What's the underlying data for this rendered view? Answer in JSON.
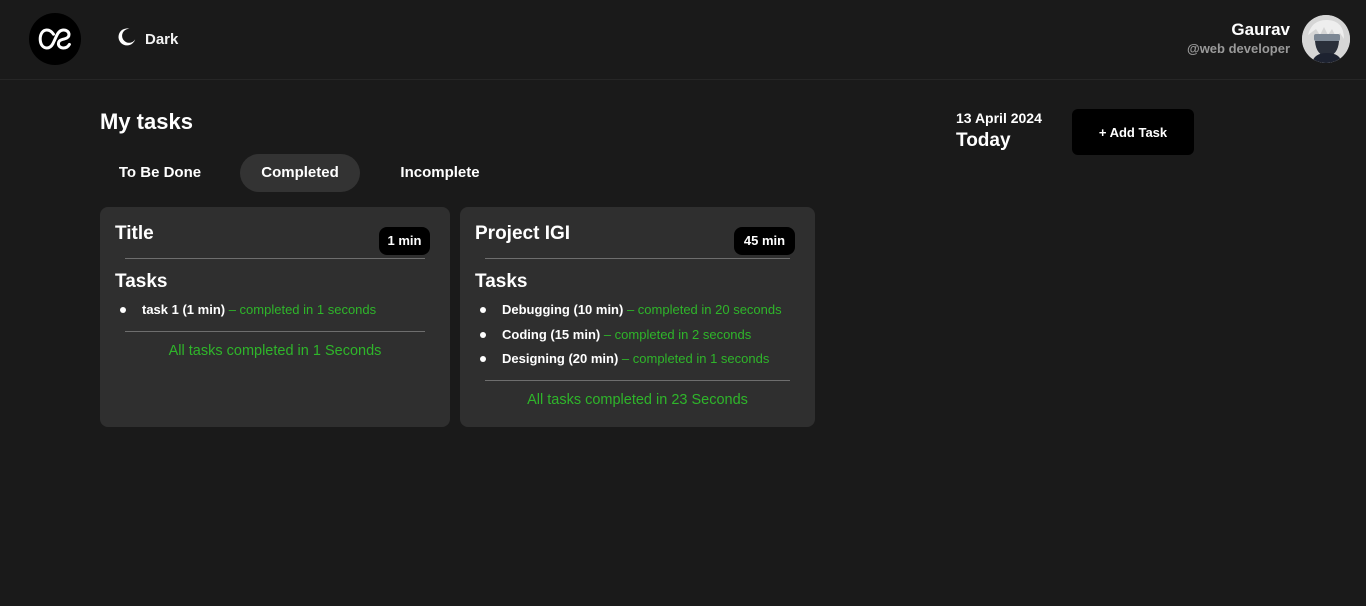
{
  "header": {
    "theme_label": "Dark",
    "user": {
      "name": "Gaurav",
      "handle": "@web developer"
    }
  },
  "main": {
    "title": "My tasks",
    "tabs": [
      {
        "label": "To Be Done",
        "active": false
      },
      {
        "label": "Completed",
        "active": true
      },
      {
        "label": "Incomplete",
        "active": false
      }
    ],
    "date": "13 April 2024",
    "today_label": "Today",
    "add_task_label": "+ Add Task"
  },
  "cards": [
    {
      "title": "Title",
      "time": "1 min",
      "tasks_heading": "Tasks",
      "tasks": [
        {
          "name": "task 1 (1 min)",
          "status": "– completed in 1 seconds"
        }
      ],
      "summary": "All tasks completed in 1 Seconds"
    },
    {
      "title": "Project IGI",
      "time": "45 min",
      "tasks_heading": "Tasks",
      "tasks": [
        {
          "name": "Debugging (10 min)",
          "status": "– completed in 20 seconds"
        },
        {
          "name": "Coding (15 min)",
          "status": "– completed in 2 seconds"
        },
        {
          "name": "Designing (20 min)",
          "status": "– completed in 1 seconds"
        }
      ],
      "summary": "All tasks completed in 23 Seconds"
    }
  ],
  "colors": {
    "background": "#1a1a1a",
    "card": "#2f2f2f",
    "active_tab": "#333333",
    "success_green": "#2fb52a",
    "button_black": "#000000"
  },
  "icons": {
    "logo": "lastfm-logo-icon",
    "theme": "moon-icon"
  }
}
